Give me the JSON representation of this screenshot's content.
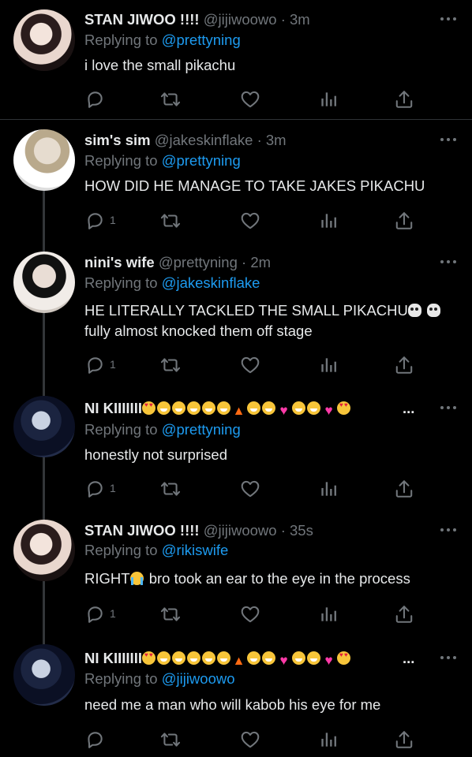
{
  "colors": {
    "background": "#000000",
    "text": "#e7e9ea",
    "muted": "#71767b",
    "link": "#1d9bf0",
    "divider": "#2f3336"
  },
  "tweets": [
    {
      "name": "STAN JIWOO !!!!",
      "handle": "@jijiwoowo",
      "time": "· 3m",
      "replying_prefix": "Replying to",
      "replying_to": "@prettyning",
      "text": "i love the small pikachu",
      "reply_count": "",
      "icons": [
        "reply-icon",
        "retweet-icon",
        "like-icon",
        "views-icon",
        "share-icon"
      ]
    },
    {
      "name": "sim's sim",
      "handle": "@jakeskinflake",
      "time": "· 3m",
      "replying_prefix": "Replying to",
      "replying_to": "@prettyning",
      "text": "HOW DID HE MANAGE TO TAKE JAKES PIKACHU",
      "reply_count": "1"
    },
    {
      "name": "nini's wife",
      "handle": "@prettyning",
      "time": "· 2m",
      "replying_prefix": "Replying to",
      "replying_to": "@jakeskinflake",
      "text": "HE LITERALLY TACKLED THE SMALL PIKACHU",
      "text_line2": "fully almost knocked them off stage",
      "reply_count": "1",
      "emoji_after": [
        "skull",
        "skull"
      ]
    },
    {
      "name": "NI KIIIIIII",
      "name_emojis": [
        "heart-eyes",
        "grin",
        "grin",
        "grin",
        "smile",
        "grin",
        "fire",
        "smile",
        "grin",
        "pink-heart",
        "grin",
        "grin",
        "pink-heart",
        "heart-eyes"
      ],
      "name_suffix": "...",
      "handle": "",
      "time": "",
      "replying_prefix": "Replying to",
      "replying_to": "@prettyning",
      "text": "honestly not surprised",
      "reply_count": "1"
    },
    {
      "name": "STAN JIWOO !!!!",
      "handle": "@jijiwoowo",
      "time": "· 35s",
      "replying_prefix": "Replying to",
      "replying_to": "@rikiswife",
      "text_a": "RIGHT",
      "text_b": " bro took an ear to the eye in the process",
      "reply_count": "1",
      "emoji_after": [
        "crying"
      ]
    },
    {
      "name": "NI KIIIIIII",
      "name_suffix": "...",
      "handle": "",
      "time": "",
      "replying_prefix": "Replying to",
      "replying_to": "@jijiwoowo",
      "text": "need me a man who will kabob his eye for me",
      "reply_count": ""
    }
  ]
}
